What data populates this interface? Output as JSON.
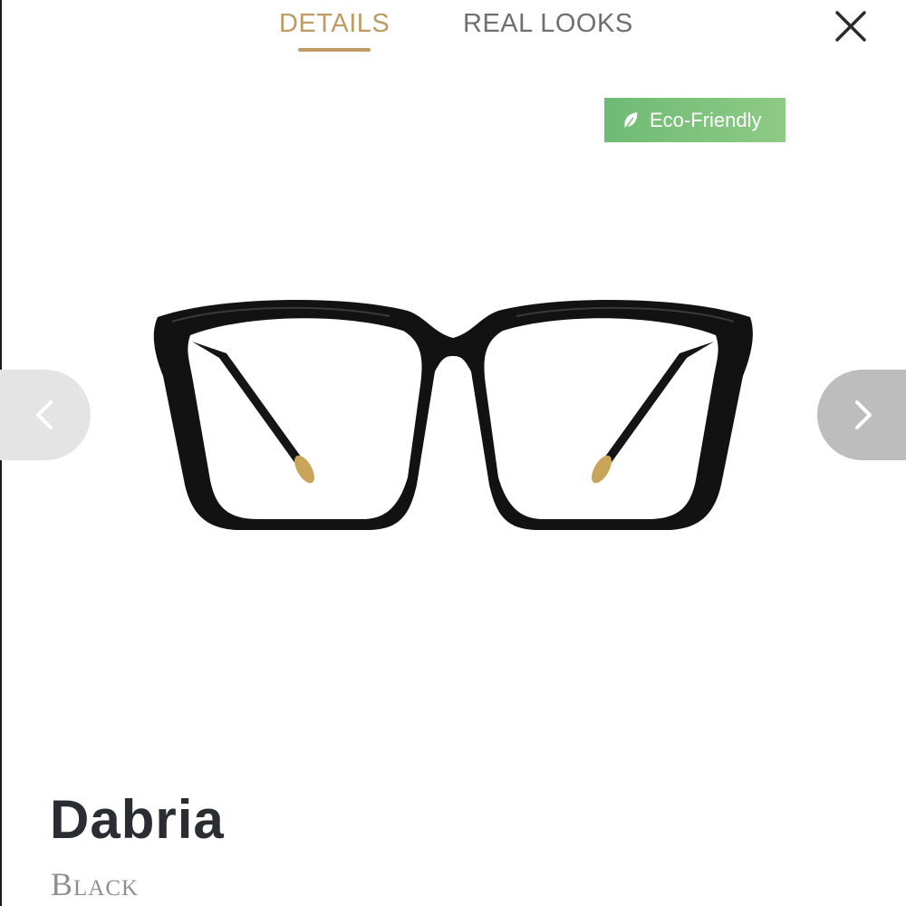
{
  "tabs": [
    {
      "label": "DETAILS",
      "active": true
    },
    {
      "label": "REAL LOOKS",
      "active": false
    }
  ],
  "badge": {
    "label": "Eco-Friendly",
    "icon": "leaf-icon",
    "color": "#78c07b"
  },
  "product": {
    "name": "Dabria",
    "color": "Black"
  },
  "icons": {
    "close": "close-icon",
    "prev": "chevron-left-icon",
    "next": "chevron-right-icon"
  },
  "colors": {
    "accent": "#bf9b63",
    "frame": "#111111",
    "text": "#2a2e33"
  }
}
